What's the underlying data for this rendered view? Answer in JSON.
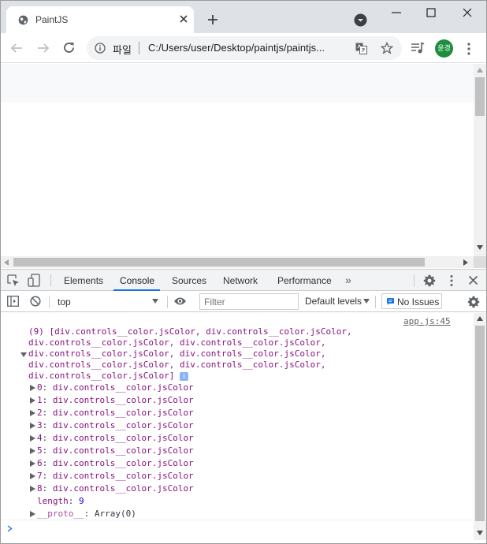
{
  "tab": {
    "title": "PaintJS"
  },
  "address": {
    "scheme": "파일",
    "url": "C:/Users/user/Desktop/paintjs/paintjs..."
  },
  "profile": {
    "initials": "윤경"
  },
  "devtools": {
    "tabs": [
      "Elements",
      "Console",
      "Sources",
      "Network",
      "Performance"
    ],
    "active_tab": "Console",
    "more": "»",
    "context": "top",
    "filter_placeholder": "Filter",
    "levels": "Default levels",
    "issues": "No Issues"
  },
  "console": {
    "source": "app.js:45",
    "summary_lines": [
      "(9) [div.controls__color.jsColor, div.controls__color.jsColor,",
      "div.controls__color.jsColor, div.controls__color.jsColor,",
      "div.controls__color.jsColor, div.controls__color.jsColor,",
      "div.controls__color.jsColor, div.controls__color.jsColor,",
      "div.controls__color.jsColor]"
    ],
    "info_badge": "i",
    "entries": [
      {
        "index": "0",
        "value": "div.controls__color.jsColor"
      },
      {
        "index": "1",
        "value": "div.controls__color.jsColor"
      },
      {
        "index": "2",
        "value": "div.controls__color.jsColor"
      },
      {
        "index": "3",
        "value": "div.controls__color.jsColor"
      },
      {
        "index": "4",
        "value": "div.controls__color.jsColor"
      },
      {
        "index": "5",
        "value": "div.controls__color.jsColor"
      },
      {
        "index": "6",
        "value": "div.controls__color.jsColor"
      },
      {
        "index": "7",
        "value": "div.controls__color.jsColor"
      },
      {
        "index": "8",
        "value": "div.controls__color.jsColor"
      }
    ],
    "length_key": "length",
    "length_value": "9",
    "proto_key": "__proto__",
    "proto_value": "Array(0)"
  },
  "colors": {
    "accent": "#1a73e8",
    "avatar": "#1e8e3e",
    "console_key": "#881280",
    "console_number": "#1c00cf"
  }
}
